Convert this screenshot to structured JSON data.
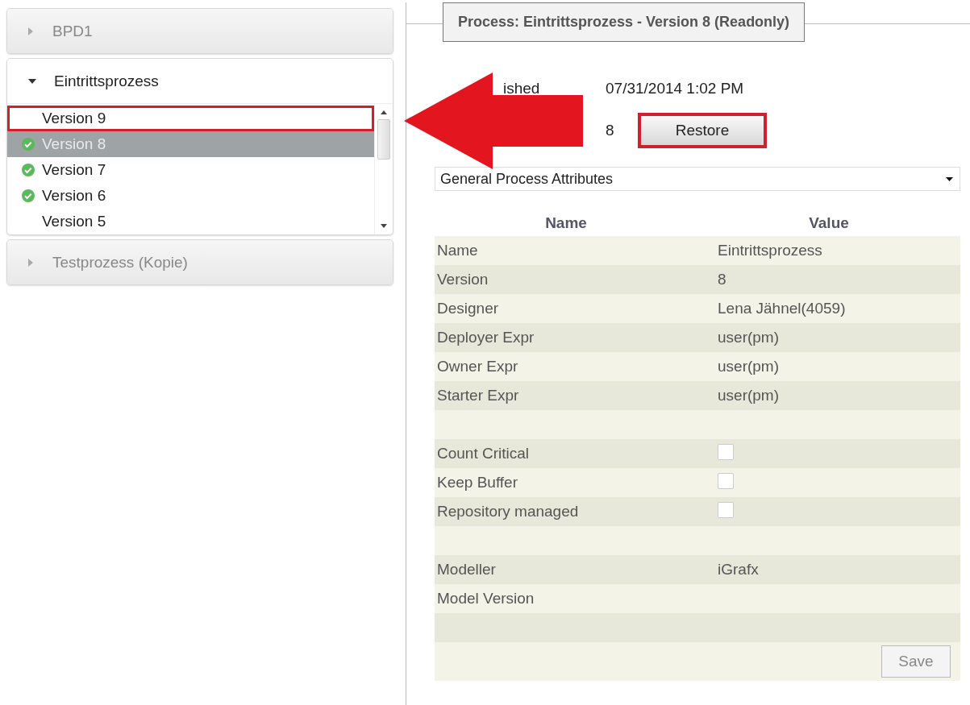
{
  "process_tree": [
    {
      "label": "BPD1",
      "expanded": false
    },
    {
      "label": "Eintrittsprozess",
      "expanded": true,
      "versions": [
        {
          "label": "Version 9",
          "selected": false,
          "deployed": false,
          "annotated": true
        },
        {
          "label": "Version 8",
          "selected": true,
          "deployed": true,
          "annotated": false
        },
        {
          "label": "Version 7",
          "selected": false,
          "deployed": true,
          "annotated": false
        },
        {
          "label": "Version 6",
          "selected": false,
          "deployed": true,
          "annotated": false
        },
        {
          "label": "Version 5",
          "selected": false,
          "deployed": false,
          "annotated": false
        }
      ]
    },
    {
      "label": "Testprozess (Kopie)",
      "expanded": false
    }
  ],
  "detail": {
    "title": "Process: Eintrittsprozess - Version 8 (Readonly)",
    "published_label": "ished",
    "published_value": "07/31/2014 1:02 PM",
    "version_value": "8",
    "restore_button": {
      "label": "Restore",
      "annotated": true
    },
    "section_select": "General Process Attributes",
    "table": {
      "columns": [
        "Name",
        "Value"
      ],
      "rows": [
        {
          "kind": "text",
          "name": "Name",
          "value": "Eintrittsprozess"
        },
        {
          "kind": "text",
          "name": "Version",
          "value": "8"
        },
        {
          "kind": "text",
          "name": "Designer",
          "value": "Lena Jähnel(4059)"
        },
        {
          "kind": "text",
          "name": "Deployer Expr",
          "value": "user(pm)"
        },
        {
          "kind": "text",
          "name": "Owner Expr",
          "value": "user(pm)"
        },
        {
          "kind": "text",
          "name": "Starter Expr",
          "value": "user(pm)"
        },
        {
          "kind": "blank"
        },
        {
          "kind": "checkbox",
          "name": "Count Critical",
          "checked": false
        },
        {
          "kind": "checkbox",
          "name": "Keep Buffer",
          "checked": false
        },
        {
          "kind": "checkbox",
          "name": "Repository managed",
          "checked": false
        },
        {
          "kind": "blank"
        },
        {
          "kind": "text",
          "name": "Modeller",
          "value": "iGrafx"
        },
        {
          "kind": "text",
          "name": "Model Version"
        },
        {
          "kind": "blank"
        }
      ]
    },
    "save_button": "Save"
  },
  "annotation_arrow": true
}
